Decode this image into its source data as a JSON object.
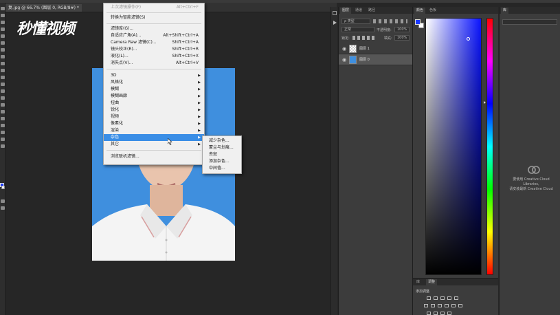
{
  "document_tab": "复.jpg @ 66.7% (图层 0, RGB/8#) *",
  "watermark": "秒懂视频",
  "filter_menu": {
    "last_filter": {
      "label": "上次滤镜操作(F)",
      "shortcut": "Alt+Ctrl+F"
    },
    "convert_smart": "转换为智能滤镜(S)",
    "items_group1": [
      {
        "label": "滤镜库(G)...",
        "shortcut": ""
      },
      {
        "label": "自适应广角(A)...",
        "shortcut": "Alt+Shift+Ctrl+A"
      },
      {
        "label": "Camera Raw 滤镜(C)...",
        "shortcut": "Shift+Ctrl+A"
      },
      {
        "label": "镜头校正(R)...",
        "shortcut": "Shift+Ctrl+R"
      },
      {
        "label": "液化(L)...",
        "shortcut": "Shift+Ctrl+X"
      },
      {
        "label": "消失点(V)...",
        "shortcut": "Alt+Ctrl+V"
      }
    ],
    "submenus": [
      "3D",
      "风格化",
      "模糊",
      "模糊画廊",
      "扭曲",
      "锐化",
      "视频",
      "像素化",
      "渲染",
      "杂色",
      "其它"
    ],
    "browse_online": "浏览联机滤镜..."
  },
  "noise_submenu": [
    "减少杂色...",
    "蒙尘与划痕...",
    "去斑",
    "添加杂色...",
    "中间值..."
  ],
  "layers_panel": {
    "tabs": [
      "图层",
      "通道",
      "路径"
    ],
    "kind_filter": "ρ 类型",
    "blend_mode": "正常",
    "opacity_label": "不透明度:",
    "opacity_value": "100%",
    "lock_label": "锁定:",
    "fill_label": "填充:",
    "fill_value": "100%",
    "layers": [
      {
        "name": "图层 1",
        "selected": false
      },
      {
        "name": "图层 0",
        "selected": true
      }
    ]
  },
  "color_panel": {
    "tabs": [
      "颜色",
      "色板"
    ],
    "foreground": "#1c3aff",
    "background": "#ffffff"
  },
  "adjustments_panel": {
    "tabs": [
      "库",
      "调整"
    ],
    "heading": "添加调整"
  },
  "libraries_panel": {
    "tab": "库",
    "message_line1": "要使用 Creative Cloud Libraries,",
    "message_line2": "请安装最新 Creative Cloud"
  }
}
